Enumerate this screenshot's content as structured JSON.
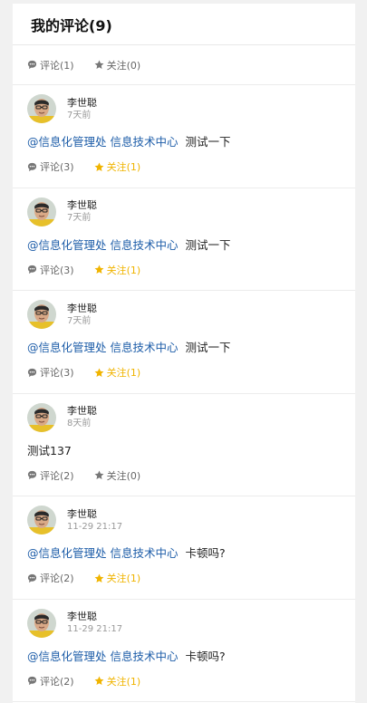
{
  "header": {
    "title": "我的评论(9)"
  },
  "top_actions": {
    "comment_label": "评论(1)",
    "follow_label": "关注(0)",
    "follow_active": false
  },
  "colors": {
    "accent_follow": "#f0b400",
    "mention": "#1c5ca8",
    "muted": "#999999"
  },
  "comments": [
    {
      "user": "李世聪",
      "time": "7天前",
      "mention": "@信息化管理处 信息技术中心",
      "text": "测试一下",
      "comment_label": "评论(3)",
      "follow_label": "关注(1)",
      "follow_active": true
    },
    {
      "user": "李世聪",
      "time": "7天前",
      "mention": "@信息化管理处 信息技术中心",
      "text": "测试一下",
      "comment_label": "评论(3)",
      "follow_label": "关注(1)",
      "follow_active": true
    },
    {
      "user": "李世聪",
      "time": "7天前",
      "mention": "@信息化管理处 信息技术中心",
      "text": "测试一下",
      "comment_label": "评论(3)",
      "follow_label": "关注(1)",
      "follow_active": true
    },
    {
      "user": "李世聪",
      "time": "8天前",
      "mention": "",
      "text": "测试137",
      "comment_label": "评论(2)",
      "follow_label": "关注(0)",
      "follow_active": false
    },
    {
      "user": "李世聪",
      "time": "11-29 21:17",
      "mention": "@信息化管理处 信息技术中心",
      "text": "卡顿吗?",
      "comment_label": "评论(2)",
      "follow_label": "关注(1)",
      "follow_active": true
    },
    {
      "user": "李世聪",
      "time": "11-29 21:17",
      "mention": "@信息化管理处 信息技术中心",
      "text": "卡顿吗?",
      "comment_label": "评论(2)",
      "follow_label": "关注(1)",
      "follow_active": true
    }
  ]
}
